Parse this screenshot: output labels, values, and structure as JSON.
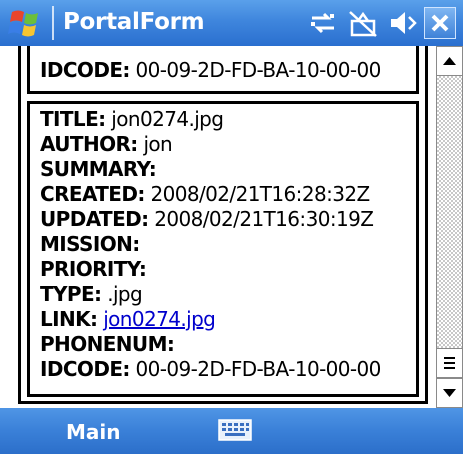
{
  "window": {
    "title": "PortalForm"
  },
  "tray": [
    "sync-icon",
    "connectivity-icon",
    "volume-icon"
  ],
  "close_glyph": "✕",
  "record_top": {
    "idcode_label": "IDCODE:",
    "idcode_value": " 00-09-2D-FD-BA-10-00-00"
  },
  "record": {
    "fields": [
      {
        "label": "TITLE:",
        "value": " jon0274.jpg"
      },
      {
        "label": "AUTHOR:",
        "value": " jon"
      },
      {
        "label": "SUMMARY:",
        "value": ""
      },
      {
        "label": "CREATED:",
        "value": " 2008/02/21T16:28:32Z"
      },
      {
        "label": "UPDATED:",
        "value": " 2008/02/21T16:30:19Z"
      },
      {
        "label": "MISSION:",
        "value": ""
      },
      {
        "label": "PRIORITY:",
        "value": ""
      },
      {
        "label": "TYPE:",
        "value": " .jpg"
      },
      {
        "label": "LINK:",
        "value": " ",
        "link": "jon0274.jpg"
      },
      {
        "label": "PHONENUM:",
        "value": ""
      },
      {
        "label": "IDCODE:",
        "value": " 00-09-2D-FD-BA-10-00-00"
      }
    ]
  },
  "menu": {
    "main_label": "Main"
  },
  "colors": {
    "titlebar": "#3f86dd",
    "link": "#0000cc",
    "menubar": "#3a80d8"
  }
}
